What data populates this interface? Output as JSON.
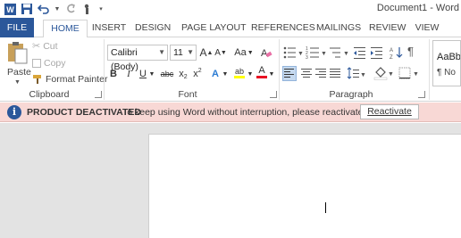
{
  "window": {
    "title": "Document1 - Word"
  },
  "tabs": [
    "FILE",
    "HOME",
    "INSERT",
    "DESIGN",
    "PAGE LAYOUT",
    "REFERENCES",
    "MAILINGS",
    "REVIEW",
    "VIEW"
  ],
  "clipboard": {
    "paste": "Paste",
    "cut": "Cut",
    "copy": "Copy",
    "format_painter": "Format Painter",
    "label": "Clipboard"
  },
  "font": {
    "name": "Calibri (Body)",
    "size": "11",
    "grow": "A",
    "shrink": "A",
    "case": "Aa",
    "bold": "B",
    "italic": "I",
    "underline": "U",
    "strike": "abc",
    "subscript": "x",
    "sub_mark": "2",
    "superscript": "x",
    "sup_mark": "2",
    "effects": "A",
    "highlight": "ab",
    "font_color": "A",
    "label": "Font"
  },
  "paragraph": {
    "label": "Paragraph"
  },
  "styles": {
    "preview": "AaBb",
    "name": "¶ No"
  },
  "notice": {
    "heading": "PRODUCT DEACTIVATED",
    "message": "To keep using Word without interruption, please reactivate now.",
    "button": "Reactivate"
  },
  "colors": {
    "brand": "#2b579a",
    "notice_bg": "#f8d8d5",
    "highlight": "#ffff00",
    "font_color": "#e81123"
  }
}
